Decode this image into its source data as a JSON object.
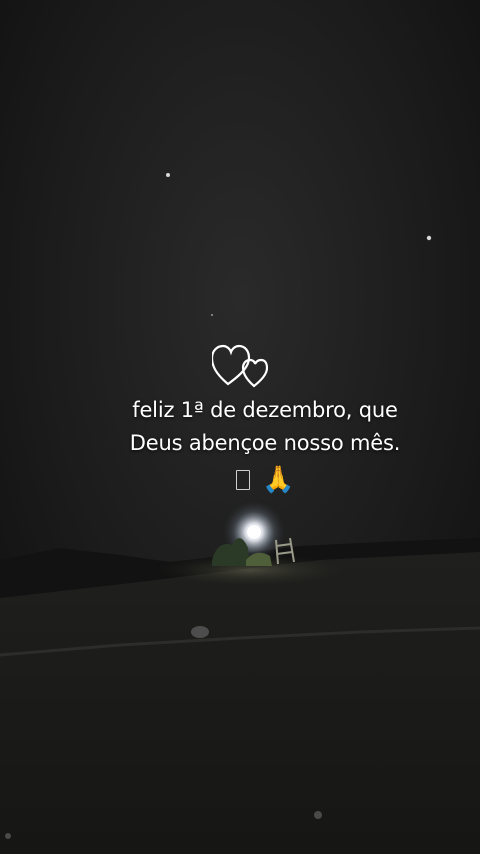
{
  "caption": {
    "line1": "feliz 1ª de dezembro, que",
    "line2": "Deus abençoe nosso mês."
  },
  "emoji": {
    "missing_glyph": "missing-glyph-box",
    "pray": "🙏"
  },
  "decor": {
    "hearts": "two-outline-hearts",
    "text_color": "#ffffff"
  }
}
